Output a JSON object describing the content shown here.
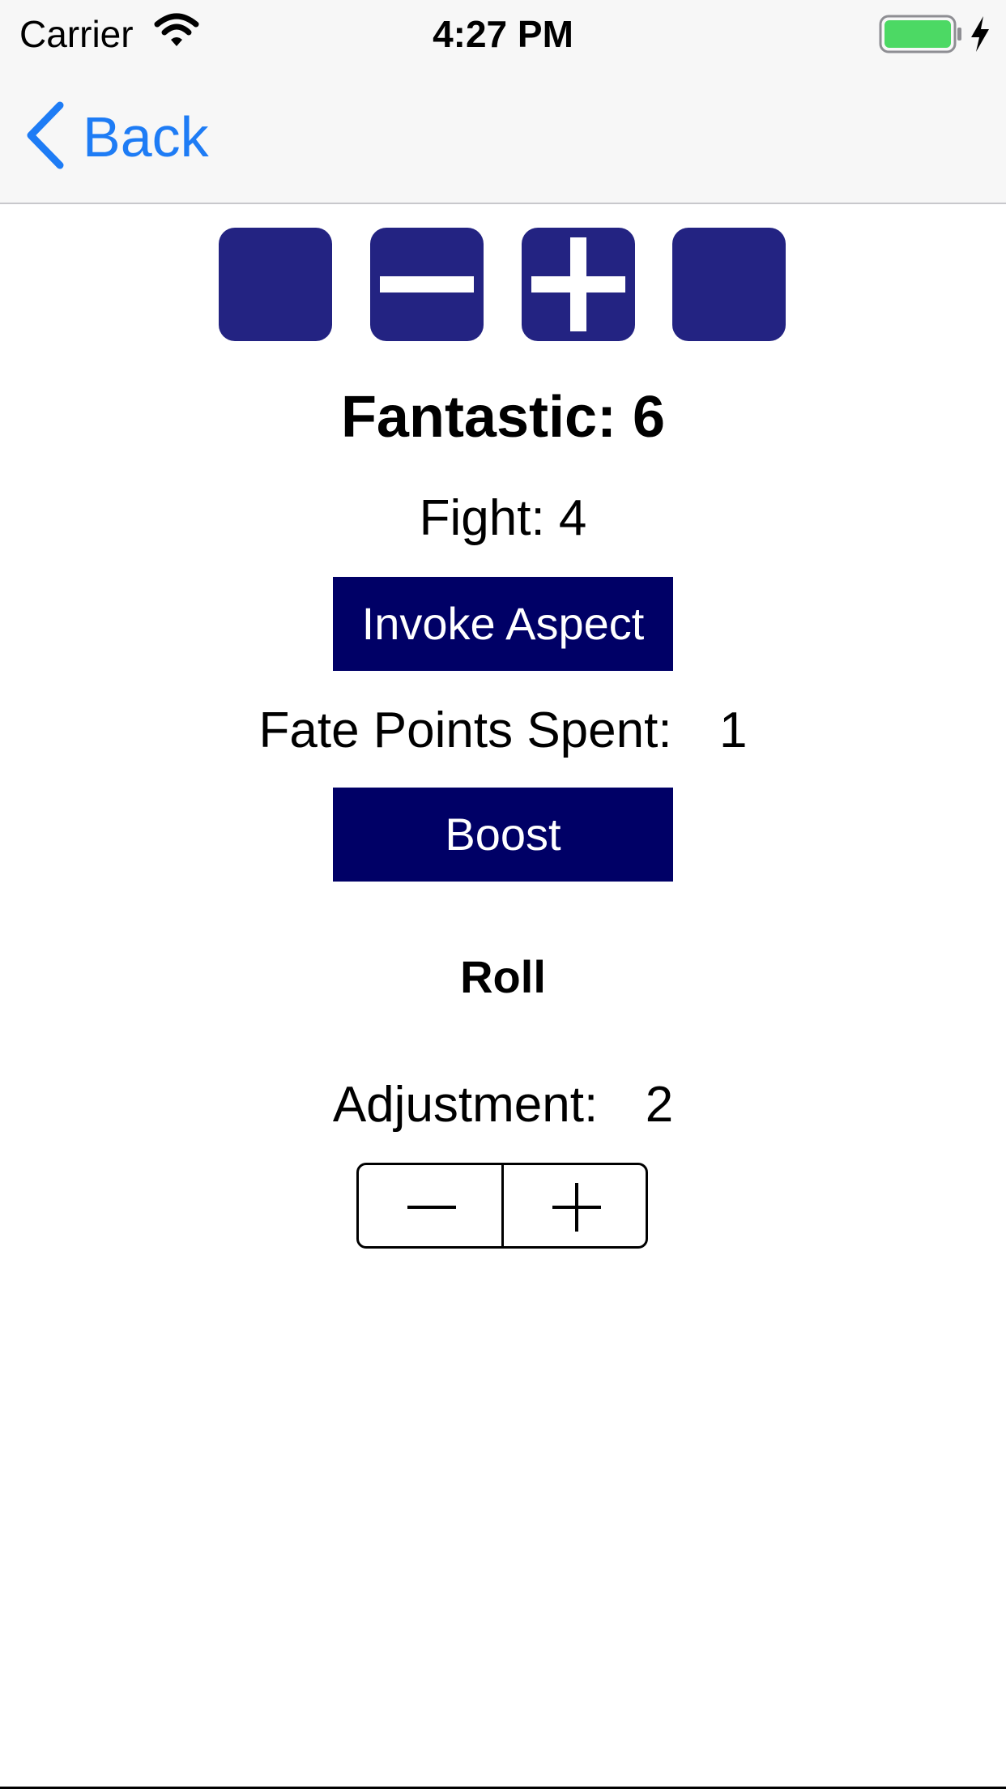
{
  "status_bar": {
    "carrier": "Carrier",
    "time": "4:27 PM",
    "battery_color": "#4cd964"
  },
  "nav": {
    "back_label": "Back",
    "accent_color": "#1e7cf5"
  },
  "dice": [
    {
      "face": "blank",
      "icon": "blank-die-icon"
    },
    {
      "face": "minus",
      "icon": "minus-die-icon"
    },
    {
      "face": "plus",
      "icon": "plus-die-icon"
    },
    {
      "face": "blank",
      "icon": "blank-die-icon"
    }
  ],
  "result": "Fantastic: 6",
  "skill": "Fight: 4",
  "invoke_button": "Invoke Aspect",
  "fate_points": {
    "label": "Fate Points Spent:",
    "value": "1"
  },
  "boost_button": "Boost",
  "roll_button": "Roll",
  "adjustment": {
    "label": "Adjustment:",
    "value": "2"
  },
  "colors": {
    "die": "#232382",
    "button": "#000066"
  }
}
